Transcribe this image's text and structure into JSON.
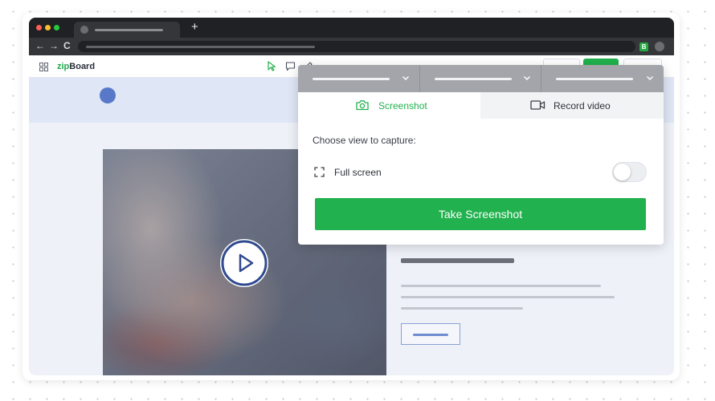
{
  "browser": {
    "new_tab_label": "+",
    "nav": {
      "back": "←",
      "forward": "→",
      "reload": "C"
    },
    "extension_badge": "B"
  },
  "app": {
    "brand_prefix": "zip",
    "brand_suffix": "Board"
  },
  "capture_panel": {
    "tabs": [
      {
        "label": "Screenshot",
        "icon": "camera-icon",
        "active": true
      },
      {
        "label": "Record video",
        "icon": "video-camera-icon",
        "active": false
      }
    ],
    "prompt": "Choose view to capture:",
    "option_label": "Full screen",
    "option_icon": "fullscreen-icon",
    "option_enabled": false,
    "action_label": "Take Screenshot"
  },
  "colors": {
    "accent_green": "#21b14e",
    "brand_blue": "#5879c8",
    "titlebar": "#202124"
  }
}
